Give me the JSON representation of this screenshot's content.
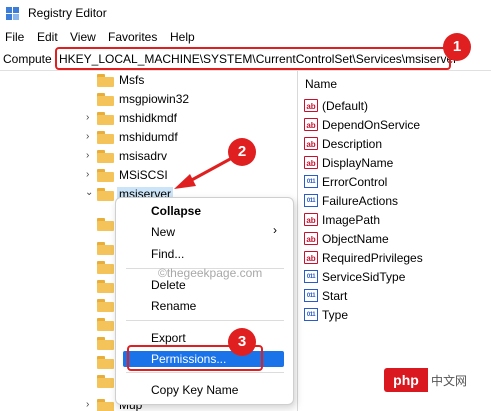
{
  "window": {
    "title": "Registry Editor"
  },
  "menu": [
    "File",
    "Edit",
    "View",
    "Favorites",
    "Help"
  ],
  "address": {
    "prefix": "Compute",
    "path": "HKEY_LOCAL_MACHINE\\SYSTEM\\CurrentControlSet\\Services\\msiserver"
  },
  "tree": {
    "items": [
      {
        "label": "Msfs",
        "expandable": false
      },
      {
        "label": "msgpiowin32",
        "expandable": false
      },
      {
        "label": "mshidkmdf",
        "expandable": true
      },
      {
        "label": "mshidumdf",
        "expandable": true
      },
      {
        "label": "msisadrv",
        "expandable": true
      },
      {
        "label": "MSiSCSI",
        "expandable": true
      },
      {
        "label": "msiserver",
        "expandable": true,
        "expanded": true,
        "selected": true
      }
    ],
    "partial_bottom": "Mup"
  },
  "values_pane": {
    "header": "Name",
    "items": [
      {
        "name": "(Default)",
        "icon": "string-value-icon"
      },
      {
        "name": "DependOnService",
        "icon": "string-value-icon"
      },
      {
        "name": "Description",
        "icon": "string-value-icon"
      },
      {
        "name": "DisplayName",
        "icon": "string-value-icon"
      },
      {
        "name": "ErrorControl",
        "icon": "binary-value-icon"
      },
      {
        "name": "FailureActions",
        "icon": "binary-value-icon"
      },
      {
        "name": "ImagePath",
        "icon": "string-value-icon"
      },
      {
        "name": "ObjectName",
        "icon": "string-value-icon"
      },
      {
        "name": "RequiredPrivileges",
        "icon": "string-value-icon"
      },
      {
        "name": "ServiceSidType",
        "icon": "binary-value-icon"
      },
      {
        "name": "Start",
        "icon": "binary-value-icon"
      },
      {
        "name": "Type",
        "icon": "binary-value-icon"
      }
    ]
  },
  "context_menu": {
    "collapse": "Collapse",
    "new": "New",
    "find": "Find...",
    "delete": "Delete",
    "rename": "Rename",
    "export": "Export",
    "permissions": "Permissions...",
    "copy_key_name": "Copy Key Name"
  },
  "annotations": {
    "badge1": "1",
    "badge2": "2",
    "badge3": "3",
    "color": "#e02020"
  },
  "watermark": "©thegeekpage.com",
  "php_logo": {
    "mark": "php",
    "text": "中文网"
  },
  "colors": {
    "folder": "#f4c45a",
    "selection": "#1a73e8",
    "string_icon": "#c8102e",
    "binary_icon": "#2a5bc7"
  }
}
